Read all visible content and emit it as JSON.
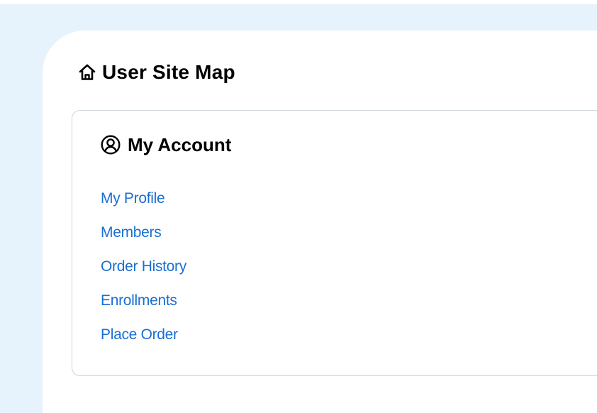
{
  "page": {
    "title": "User Site Map",
    "icon": "home-icon"
  },
  "account": {
    "title": "My Account",
    "icon": "user-circle-icon",
    "links": [
      {
        "label": "My Profile"
      },
      {
        "label": "Members"
      },
      {
        "label": "Order History"
      },
      {
        "label": "Enrollments"
      },
      {
        "label": "Place Order"
      }
    ]
  },
  "colors": {
    "background": "#e6f3fc",
    "link": "#1a6fd1",
    "card_border": "#cfd5db"
  }
}
